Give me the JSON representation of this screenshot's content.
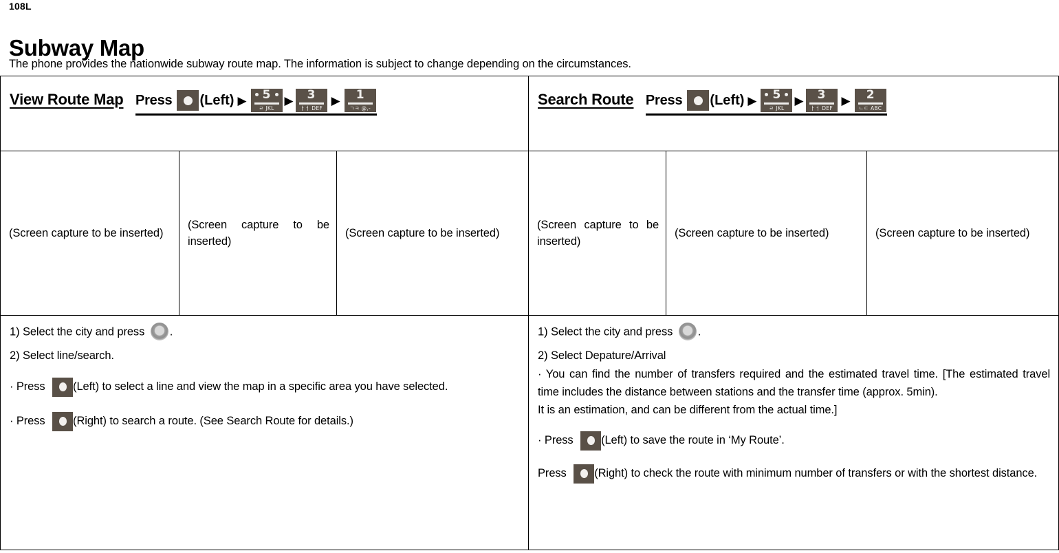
{
  "page": {
    "code": "108L",
    "title": "Subway Map",
    "intro": "The phone provides the nationwide subway route map. The information is subject to change depending on the circumstances."
  },
  "colors": {
    "key_background": "#5a5148",
    "key_foreground": "#efeeec",
    "border": "#000000",
    "text": "#000000"
  },
  "sections": {
    "left": {
      "title": "View Route Map",
      "press_label": "Press",
      "softkey_side": "(Left)",
      "keys": [
        {
          "digit": "5",
          "sub": "ㄹ JKL",
          "nubs": true
        },
        {
          "digit": "3",
          "sub": "ㅏㅓ DEF",
          "nubs": false
        },
        {
          "digit": "1",
          "sub": "ㄱㅋ @,-",
          "nubs": false
        }
      ],
      "arrow": "▶",
      "captures": [
        "(Screen capture to be inserted)",
        "(Screen capture to be inserted)",
        "(Screen capture to be inserted)"
      ],
      "steps": {
        "step1_before": "1) Select the city and press",
        "step1_after": ".",
        "step2": "2) Select line/search.",
        "bullet1_before": "· Press",
        "bullet1_after": "(Left) to select a line and view the map in a specific area you have selected.",
        "bullet2_before": "· Press",
        "bullet2_after": "(Right) to search a route. (See Search Route for details.)"
      }
    },
    "right": {
      "title": "Search Route",
      "press_label": "Press",
      "softkey_side": "(Left)",
      "keys": [
        {
          "digit": "5",
          "sub": "ㄹ JKL",
          "nubs": true
        },
        {
          "digit": "3",
          "sub": "ㅏㅓ DEF",
          "nubs": false
        },
        {
          "digit": "2",
          "sub": "ㄴㄷ ABC",
          "nubs": false
        }
      ],
      "arrow": "▶",
      "captures": [
        "(Screen capture to be inserted)",
        "(Screen capture to be inserted)",
        "(Screen capture to be inserted)"
      ],
      "steps": {
        "step1_before": "1) Select the city and press",
        "step1_after": ".",
        "step2": "2) Select Depature/Arrival",
        "note_para": "· You can find the number of transfers required and the estimated travel time. [The estimated travel time includes the distance between stations and the transfer time (approx. 5min).",
        "note_para2": "It is an estimation, and can be different from the actual time.]",
        "bullet1_before": "· Press",
        "bullet1_after": "(Left) to save the route in ‘My Route’.",
        "bullet2_before": "Press",
        "bullet2_after": "(Right) to check the route with minimum number of transfers or with the shortest distance."
      }
    }
  },
  "icons": {
    "softkey": "softkey-icon",
    "ok_button": "ok-button-icon",
    "arrow": "arrow-right-icon"
  }
}
